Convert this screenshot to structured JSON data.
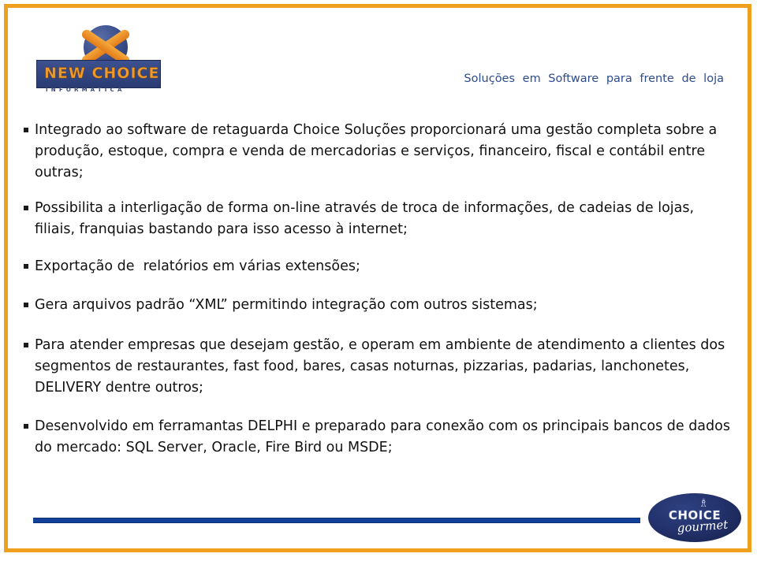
{
  "slide": {
    "border_color": "#EFA01E",
    "background": "#ffffff"
  },
  "header": {
    "logo": {
      "wordmark": "NEW CHOICE",
      "subtitle": "INFORMÁTICA",
      "icon": "x-mark-globe-logo",
      "colors": {
        "orange": "#F09A2B",
        "blue": "#2a3b72"
      }
    },
    "tagline": "Soluções em Software para frente de loja",
    "tagline_color": "#2E4C8B"
  },
  "content": {
    "bullet_marker": "square-bullet",
    "bullets": [
      {
        "id": "bullet-integracao-retaguarda",
        "text": "Integrado ao software de retaguarda Choice Soluções proporcionará uma gestão completa sobre a produção, estoque, compra e venda de mercadorias e serviços, financeiro, fiscal e contábil entre outras;"
      },
      {
        "id": "bullet-interligacao-online",
        "text": "Possibilita a interligação de forma on-line através de troca de informações, de cadeias de lojas, filiais, franquias bastando para isso acesso à internet;"
      },
      {
        "id": "bullet-exportacao-relatorios",
        "text": "Exportação de  relatórios em várias extensões;"
      },
      {
        "id": "bullet-arquivos-xml",
        "text": "Gera arquivos padrão “XML” permitindo integração com outros sistemas;"
      },
      {
        "id": "bullet-segmentos-atendimento",
        "text": "Para atender empresas que desejam gestão, e operam em ambiente de atendimento a clientes dos segmentos de restaurantes, fast food, bares, casas noturnas, pizzarias, padarias, lanchonetes, DELIVERY dentre outros;"
      },
      {
        "id": "bullet-delphi-bancos-dados",
        "text": "Desenvolvido em ferramantas DELPHI e preparado para conexão com os principais bancos de dados do mercado: SQL Server, Oracle, Fire Bird ou MSDE;"
      }
    ]
  },
  "footer": {
    "rule_color": "#123F98",
    "logo": {
      "name": "CHOICE",
      "script": "gourmet",
      "icon": "chef-hat-icon",
      "background": "#22316a"
    }
  }
}
